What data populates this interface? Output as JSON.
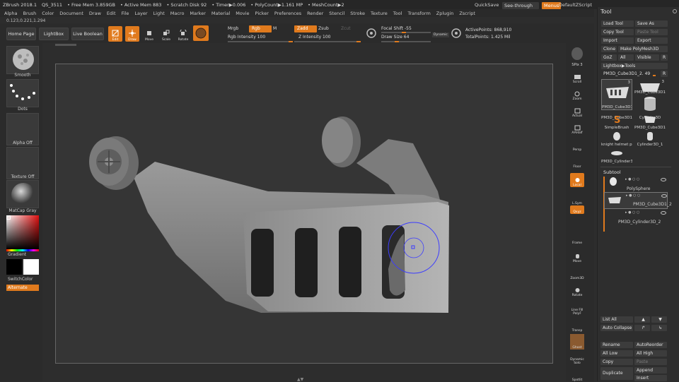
{
  "titlebar": {
    "items": [
      "ZBrush 2018.1",
      "QS_3511",
      "• Free Mem 3.859GB",
      "• Active Mem 883",
      "• Scratch Disk 92",
      "• Timer▶0.006",
      "• PolyCount▶1.161 MP",
      "• MeshCount▶2"
    ],
    "quicksave": "QuickSave",
    "see_through": "See-through   0",
    "menus": "Menus",
    "default_script": "DefaultZScript"
  },
  "menubar": [
    "Alpha",
    "Brush",
    "Color",
    "Document",
    "Draw",
    "Edit",
    "File",
    "Layer",
    "Light",
    "Macro",
    "Marker",
    "Material",
    "Movie",
    "Picker",
    "Preferences",
    "Render",
    "Stencil",
    "Stroke",
    "Texture",
    "Tool",
    "Transform",
    "Zplugin",
    "Zscript"
  ],
  "coords": "0.123,0.221,1.294",
  "topshelf": {
    "home_page": "Home Page",
    "lightbox": "LightBox",
    "live_boolean": "Live Boolean",
    "edit": "Edit",
    "draw": "Draw",
    "move": "Move",
    "scale": "Scale",
    "rotate": "Rotate",
    "mrgb": "Mrgb",
    "rgb": "Rgb",
    "m": "M",
    "zadd": "Zadd",
    "zsub": "Zsub",
    "zcut": "Zcut",
    "rgb_intensity": "Rgb Intensity 100",
    "z_intensity": "Z Intensity 100",
    "focal_shift": "Focal Shift -55",
    "draw_size": "Draw Size 64",
    "dynamic": "Dynamic",
    "active_points": "ActivePoints: 868,910",
    "total_points": "TotalPoints: 1.425 Mil"
  },
  "leftshelf": {
    "brush": "Smooth",
    "stroke": "Dots",
    "alpha": "Alpha Off",
    "texture": "Texture Off",
    "material": "MatCap Gray",
    "gradient": "Gradient",
    "switch_color": "SwitchColor",
    "alternate": "Alternate"
  },
  "rightshelf": [
    "SPix 3",
    "Scroll",
    "Zoom",
    "Actual",
    "AAHalf",
    "Persp",
    "Floor",
    "Local",
    "L.Sym",
    "Qxyz",
    "Frame",
    "Move",
    "Zoom3D",
    "Rotate",
    "Line Fill PolyF",
    "Transp",
    "Ghost",
    "Dynamic Solo",
    "Spotlit"
  ],
  "toolpanel": {
    "title": "Tool",
    "load_tool": "Load Tool",
    "save_as": "Save As",
    "copy_tool": "Copy Tool",
    "paste_tool": "Paste Tool",
    "import": "Import",
    "export": "Export",
    "clone": "Clone",
    "make_polymesh": "Make PolyMesh3D",
    "goz": "GoZ",
    "all": "All",
    "visible": "Visible",
    "r": "R",
    "lightbox_tools": "Lightbox▶Tools",
    "current_tool": "PM3D_Cube3D1_2. 49",
    "current_r": "R",
    "tiles": [
      {
        "label": "PM3D_Cube3D1",
        "count": "3"
      },
      {
        "label": "PM3D_Cube3D1",
        "count": "3"
      },
      {
        "label": "PM3D_Cube3D1",
        "count": ""
      },
      {
        "label": "Cylinder3D",
        "count": ""
      },
      {
        "label": "SimpleBrush",
        "count": ""
      },
      {
        "label": "PM3D_Cube3D1",
        "count": ""
      },
      {
        "label": "knight helmet pa",
        "count": ""
      },
      {
        "label": "Cylinder3D_1",
        "count": ""
      },
      {
        "label": "PM3D_Cylinder3",
        "count": ""
      }
    ],
    "subtool_title": "Subtool",
    "subtools": [
      "PolySphere",
      "PM3D_Cube3D1_2",
      "PM3D_Cylinder3D_2"
    ],
    "list_all": "List All",
    "auto_collapse": "Auto Collapse",
    "rename": "Rename",
    "auto_reorder": "AutoReorder",
    "all_low": "All Low",
    "all_high": "All High",
    "copy": "Copy",
    "paste": "Paste",
    "duplicate": "Duplicate",
    "append": "Append",
    "insert": "Insert"
  },
  "colors": {
    "accent": "#e07a1d",
    "background": "#2d2d2d",
    "canvas": "#353535",
    "model": "#8a8a8a",
    "cursor": "#3c3cff"
  }
}
